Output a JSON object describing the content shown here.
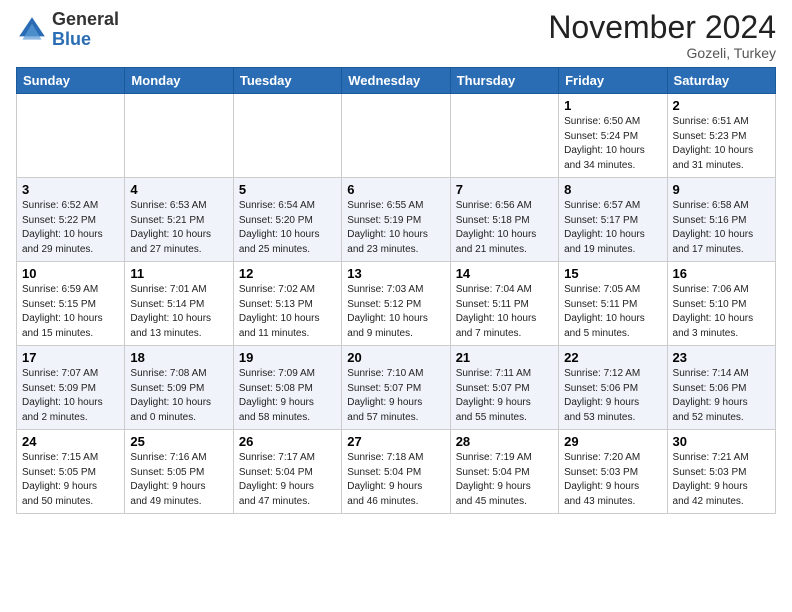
{
  "header": {
    "logo_general": "General",
    "logo_blue": "Blue",
    "month": "November 2024",
    "location": "Gozeli, Turkey"
  },
  "days_of_week": [
    "Sunday",
    "Monday",
    "Tuesday",
    "Wednesday",
    "Thursday",
    "Friday",
    "Saturday"
  ],
  "weeks": [
    [
      {
        "day": "",
        "info": ""
      },
      {
        "day": "",
        "info": ""
      },
      {
        "day": "",
        "info": ""
      },
      {
        "day": "",
        "info": ""
      },
      {
        "day": "",
        "info": ""
      },
      {
        "day": "1",
        "info": "Sunrise: 6:50 AM\nSunset: 5:24 PM\nDaylight: 10 hours\nand 34 minutes."
      },
      {
        "day": "2",
        "info": "Sunrise: 6:51 AM\nSunset: 5:23 PM\nDaylight: 10 hours\nand 31 minutes."
      }
    ],
    [
      {
        "day": "3",
        "info": "Sunrise: 6:52 AM\nSunset: 5:22 PM\nDaylight: 10 hours\nand 29 minutes."
      },
      {
        "day": "4",
        "info": "Sunrise: 6:53 AM\nSunset: 5:21 PM\nDaylight: 10 hours\nand 27 minutes."
      },
      {
        "day": "5",
        "info": "Sunrise: 6:54 AM\nSunset: 5:20 PM\nDaylight: 10 hours\nand 25 minutes."
      },
      {
        "day": "6",
        "info": "Sunrise: 6:55 AM\nSunset: 5:19 PM\nDaylight: 10 hours\nand 23 minutes."
      },
      {
        "day": "7",
        "info": "Sunrise: 6:56 AM\nSunset: 5:18 PM\nDaylight: 10 hours\nand 21 minutes."
      },
      {
        "day": "8",
        "info": "Sunrise: 6:57 AM\nSunset: 5:17 PM\nDaylight: 10 hours\nand 19 minutes."
      },
      {
        "day": "9",
        "info": "Sunrise: 6:58 AM\nSunset: 5:16 PM\nDaylight: 10 hours\nand 17 minutes."
      }
    ],
    [
      {
        "day": "10",
        "info": "Sunrise: 6:59 AM\nSunset: 5:15 PM\nDaylight: 10 hours\nand 15 minutes."
      },
      {
        "day": "11",
        "info": "Sunrise: 7:01 AM\nSunset: 5:14 PM\nDaylight: 10 hours\nand 13 minutes."
      },
      {
        "day": "12",
        "info": "Sunrise: 7:02 AM\nSunset: 5:13 PM\nDaylight: 10 hours\nand 11 minutes."
      },
      {
        "day": "13",
        "info": "Sunrise: 7:03 AM\nSunset: 5:12 PM\nDaylight: 10 hours\nand 9 minutes."
      },
      {
        "day": "14",
        "info": "Sunrise: 7:04 AM\nSunset: 5:11 PM\nDaylight: 10 hours\nand 7 minutes."
      },
      {
        "day": "15",
        "info": "Sunrise: 7:05 AM\nSunset: 5:11 PM\nDaylight: 10 hours\nand 5 minutes."
      },
      {
        "day": "16",
        "info": "Sunrise: 7:06 AM\nSunset: 5:10 PM\nDaylight: 10 hours\nand 3 minutes."
      }
    ],
    [
      {
        "day": "17",
        "info": "Sunrise: 7:07 AM\nSunset: 5:09 PM\nDaylight: 10 hours\nand 2 minutes."
      },
      {
        "day": "18",
        "info": "Sunrise: 7:08 AM\nSunset: 5:09 PM\nDaylight: 10 hours\nand 0 minutes."
      },
      {
        "day": "19",
        "info": "Sunrise: 7:09 AM\nSunset: 5:08 PM\nDaylight: 9 hours\nand 58 minutes."
      },
      {
        "day": "20",
        "info": "Sunrise: 7:10 AM\nSunset: 5:07 PM\nDaylight: 9 hours\nand 57 minutes."
      },
      {
        "day": "21",
        "info": "Sunrise: 7:11 AM\nSunset: 5:07 PM\nDaylight: 9 hours\nand 55 minutes."
      },
      {
        "day": "22",
        "info": "Sunrise: 7:12 AM\nSunset: 5:06 PM\nDaylight: 9 hours\nand 53 minutes."
      },
      {
        "day": "23",
        "info": "Sunrise: 7:14 AM\nSunset: 5:06 PM\nDaylight: 9 hours\nand 52 minutes."
      }
    ],
    [
      {
        "day": "24",
        "info": "Sunrise: 7:15 AM\nSunset: 5:05 PM\nDaylight: 9 hours\nand 50 minutes."
      },
      {
        "day": "25",
        "info": "Sunrise: 7:16 AM\nSunset: 5:05 PM\nDaylight: 9 hours\nand 49 minutes."
      },
      {
        "day": "26",
        "info": "Sunrise: 7:17 AM\nSunset: 5:04 PM\nDaylight: 9 hours\nand 47 minutes."
      },
      {
        "day": "27",
        "info": "Sunrise: 7:18 AM\nSunset: 5:04 PM\nDaylight: 9 hours\nand 46 minutes."
      },
      {
        "day": "28",
        "info": "Sunrise: 7:19 AM\nSunset: 5:04 PM\nDaylight: 9 hours\nand 45 minutes."
      },
      {
        "day": "29",
        "info": "Sunrise: 7:20 AM\nSunset: 5:03 PM\nDaylight: 9 hours\nand 43 minutes."
      },
      {
        "day": "30",
        "info": "Sunrise: 7:21 AM\nSunset: 5:03 PM\nDaylight: 9 hours\nand 42 minutes."
      }
    ]
  ]
}
